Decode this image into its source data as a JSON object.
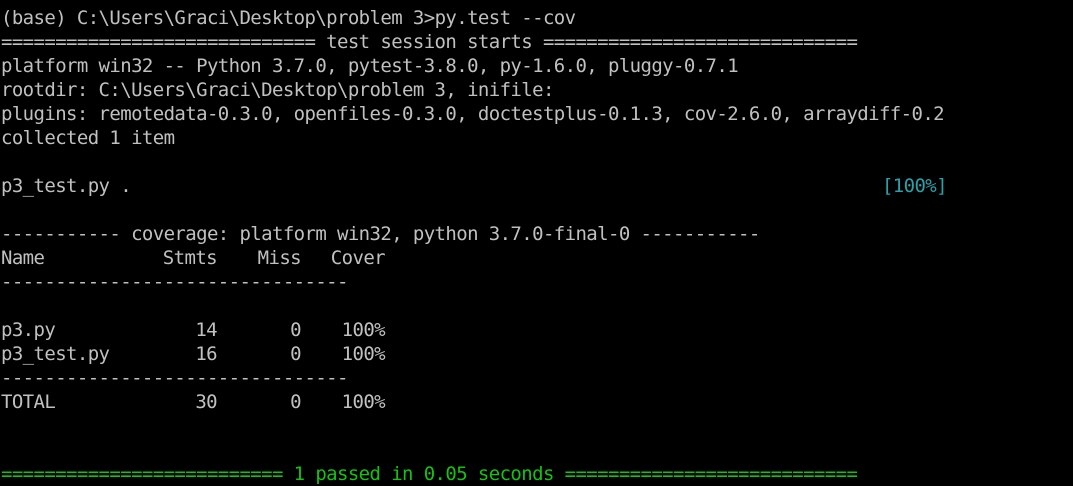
{
  "command": {
    "prompt": "(base) C:\\Users\\Graci\\Desktop\\problem 3>",
    "text": "py.test --cov"
  },
  "session_header": "============================= test session starts =============================",
  "platform_line": "platform win32 -- Python 3.7.0, pytest-3.8.0, py-1.6.0, pluggy-0.7.1",
  "rootdir_line": "rootdir: C:\\Users\\Graci\\Desktop\\problem 3, inifile:",
  "plugins_line": "plugins: remotedata-0.3.0, openfiles-0.3.0, doctestplus-0.1.3, cov-2.6.0, arraydiff-0.2",
  "collected_line": "collected 1 item",
  "test_result": {
    "file": "p3_test.py .",
    "progress": "[100%]"
  },
  "coverage_header": "----------- coverage: platform win32, python 3.7.0-final-0 -----------",
  "coverage": {
    "columns": [
      "Name",
      "Stmts",
      "Miss",
      "Cover"
    ],
    "separator": "--------------------------------",
    "rows": [
      {
        "name": "p3.py",
        "stmts": "14",
        "miss": "0",
        "cover": "100%"
      },
      {
        "name": "p3_test.py",
        "stmts": "16",
        "miss": "0",
        "cover": "100%"
      }
    ],
    "total": {
      "name": "TOTAL",
      "stmts": "30",
      "miss": "0",
      "cover": "100%"
    }
  },
  "summary_line": "========================== 1 passed in 0.05 seconds ===========================",
  "colors": {
    "background": "#000000",
    "text": "#c0c0c0",
    "green": "#13c40f",
    "cyan": "#2aa1a8"
  }
}
